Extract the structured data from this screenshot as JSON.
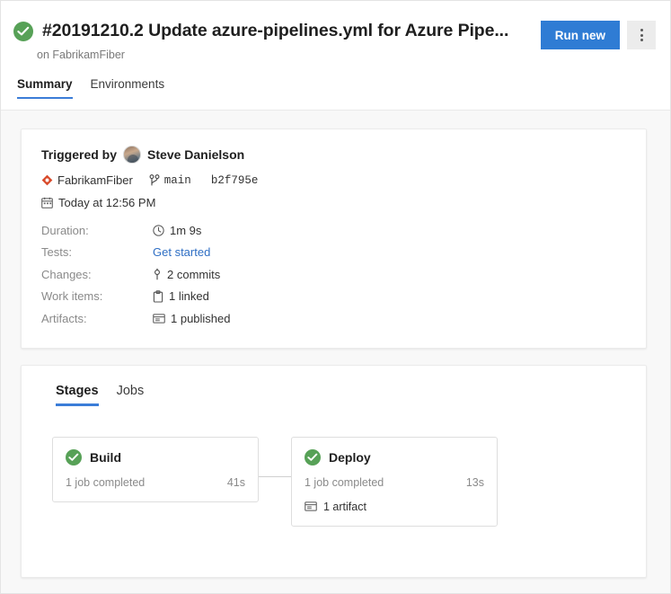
{
  "header": {
    "status_icon": "success-check-icon",
    "run_title": "#20191210.2 Update azure-pipelines.yml for Azure Pipe...",
    "run_subtitle": "on FabrikamFiber",
    "run_new_label": "Run new",
    "overflow_label": "more-actions",
    "accent_color": "#2f7cd4",
    "success_color": "#57a157"
  },
  "tabs": [
    {
      "label": "Summary",
      "active": true
    },
    {
      "label": "Environments",
      "active": false
    }
  ],
  "summary": {
    "triggered_by_label": "Triggered by",
    "triggered_by_user": "Steve Danielson",
    "repo_name": "FabrikamFiber",
    "branch_name": "main",
    "commit_hash": "b2f795e",
    "date_text": "Today at 12:56 PM",
    "details": [
      {
        "label": "Duration:",
        "value": "1m 9s",
        "icon": "clock-icon",
        "is_link": false
      },
      {
        "label": "Tests:",
        "value": "Get started",
        "icon": "",
        "is_link": true
      },
      {
        "label": "Changes:",
        "value": "2 commits",
        "icon": "commit-icon",
        "is_link": false
      },
      {
        "label": "Work items:",
        "value": "1 linked",
        "icon": "work-item-icon",
        "is_link": false
      },
      {
        "label": "Artifacts:",
        "value": "1 published",
        "icon": "artifact-icon",
        "is_link": false
      }
    ]
  },
  "stages_section": {
    "sub_tabs": [
      {
        "label": "Stages",
        "active": true
      },
      {
        "label": "Jobs",
        "active": false
      }
    ],
    "stages": [
      {
        "name": "Build",
        "status": "succeeded",
        "jobs_text": "1 job completed",
        "duration": "41s",
        "artifact_text": ""
      },
      {
        "name": "Deploy",
        "status": "succeeded",
        "jobs_text": "1 job completed",
        "duration": "13s",
        "artifact_text": "1 artifact"
      }
    ]
  }
}
